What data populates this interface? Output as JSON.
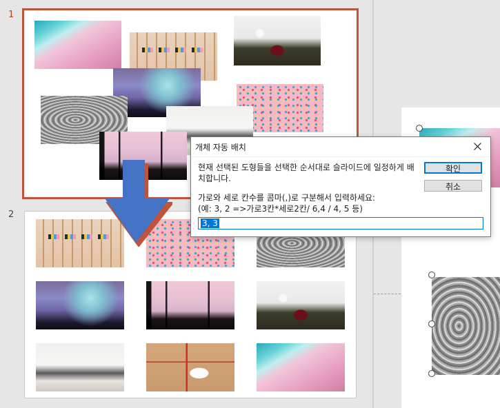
{
  "thumbnails": {
    "slides": [
      {
        "number": "1",
        "active": true
      },
      {
        "number": "2",
        "active": false
      }
    ]
  },
  "dialog": {
    "title": "개체 자동 배치",
    "message": "현재 선택된 도형들을 선택한 순서대로 슬라이드에 일정하게 배치합니다.",
    "prompt_line1": "가로와 세로 칸수를 콤마(,)로 구분해서 입력하세요:",
    "prompt_line2": "(예: 3, 2 =>가로3칸*세로2칸/ 6,4  / 4, 5 등)",
    "ok_label": "확인",
    "cancel_label": "취소",
    "input_value": "3, 3"
  },
  "icons": {
    "close": "close-icon",
    "arrow": "down-arrow-icon"
  },
  "colors": {
    "active_border": "#c0543a",
    "accent": "#0078d7",
    "arrow_fill": "#4472c4"
  }
}
